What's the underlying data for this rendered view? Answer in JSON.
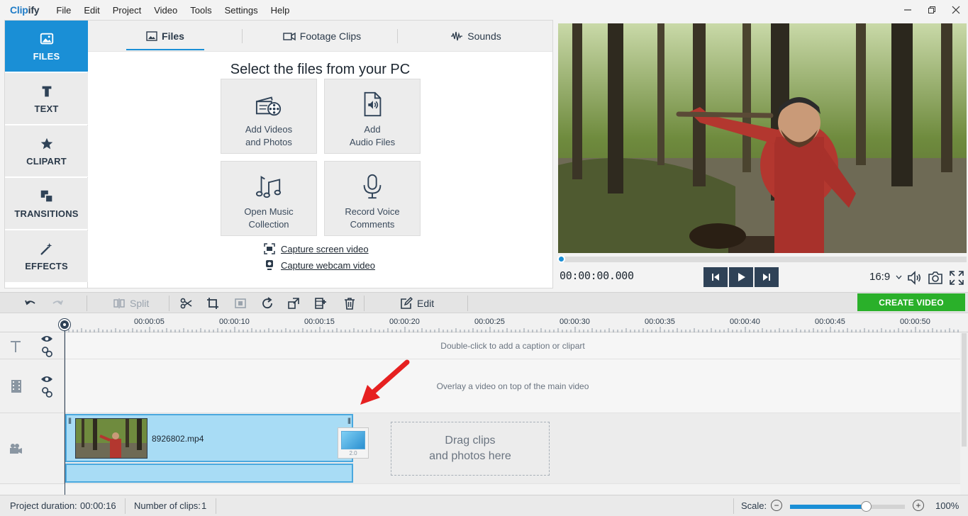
{
  "app": {
    "logo_prefix": "Clip",
    "logo_suffix": "ify",
    "menu": [
      "File",
      "Edit",
      "Project",
      "Video",
      "Tools",
      "Settings",
      "Help"
    ]
  },
  "sidebar": {
    "items": [
      {
        "label": "FILES",
        "icon": "image-icon",
        "active": true
      },
      {
        "label": "TEXT",
        "icon": "text-icon"
      },
      {
        "label": "CLIPART",
        "icon": "star-icon"
      },
      {
        "label": "TRANSITIONS",
        "icon": "transitions-icon"
      },
      {
        "label": "EFFECTS",
        "icon": "magic-wand-icon"
      }
    ]
  },
  "files_panel": {
    "tabs": [
      {
        "label": "Files",
        "icon": "image-icon",
        "active": true
      },
      {
        "label": "Footage Clips",
        "icon": "camera-icon"
      },
      {
        "label": "Sounds",
        "icon": "waveform-icon"
      }
    ],
    "title": "Select the files from your PC",
    "tiles": [
      {
        "label": "Add Videos\nand Photos",
        "icon": "film-reel-icon"
      },
      {
        "label": "Add\nAudio Files",
        "icon": "audio-file-icon"
      },
      {
        "label": "Open Music\nCollection",
        "icon": "music-notes-icon"
      },
      {
        "label": "Record Voice\nComments",
        "icon": "microphone-icon"
      }
    ],
    "capture_screen": "Capture screen video",
    "capture_webcam": "Capture webcam video"
  },
  "player": {
    "time": "00:00:00.000",
    "aspect": "16:9",
    "progress": 0,
    "accent": "#1a8fd6"
  },
  "toolbar": {
    "split_label": "Split",
    "edit_label": "Edit",
    "create_video": "CREATE VIDEO",
    "create_color": "#2ab02a"
  },
  "ruler": {
    "labels": [
      "00:00:05",
      "00:00:10",
      "00:00:15",
      "00:00:20",
      "00:00:25",
      "00:00:30",
      "00:00:35",
      "00:00:40",
      "00:00:45",
      "00:00:50"
    ]
  },
  "tracks": {
    "caption_hint": "Double-click to add a caption or clipart",
    "overlay_hint": "Overlay a video on top of the main video",
    "clip_name": "8926802.mp4",
    "transition_duration": "2.0",
    "drop_hint": "Drag clips\nand photos here"
  },
  "statusbar": {
    "duration_label": "Project duration:",
    "duration_value": "00:00:16",
    "clips_label": "Number of clips:",
    "clips_value": "1",
    "scale_label": "Scale:",
    "scale_percent": "100%",
    "scale_level": 0.66
  }
}
